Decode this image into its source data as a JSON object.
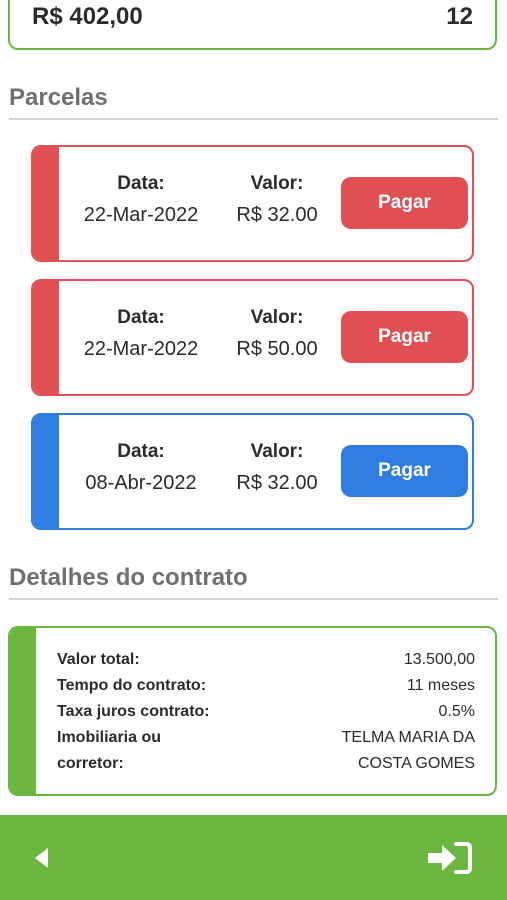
{
  "summary": {
    "amount": "R$ 402,00",
    "count": "12"
  },
  "parcelas_section": {
    "title": "Parcelas"
  },
  "parcelas": [
    {
      "date_label": "Data:",
      "date": "22-Mar-2022",
      "value_label": "Valor:",
      "value": "R$ 32.00",
      "button": "Pagar",
      "status_color": "#e04f54"
    },
    {
      "date_label": "Data:",
      "date": "22-Mar-2022",
      "value_label": "Valor:",
      "value": "R$ 50.00",
      "button": "Pagar",
      "status_color": "#e04f54"
    },
    {
      "date_label": "Data:",
      "date": "08-Abr-2022",
      "value_label": "Valor:",
      "value": "R$ 32.00",
      "button": "Pagar",
      "status_color": "#2f7de1"
    }
  ],
  "contract_section": {
    "title": "Detalhes do contrato"
  },
  "contract": {
    "total_label": "Valor total:",
    "total": "13.500,00",
    "duration_label": "Tempo do contrato:",
    "duration": "11 meses",
    "rate_label": "Taxa juros contrato:",
    "rate": "0.5%",
    "agent_label_1": "Imobiliaria ou",
    "agent_label_2": "corretor:",
    "agent_1": "TELMA MARIA DA",
    "agent_2": "COSTA GOMES"
  },
  "bottom_nav": {
    "back_icon": "back-triangle-icon",
    "exit_icon": "sign-in-icon",
    "accent": "#6bb63f"
  }
}
